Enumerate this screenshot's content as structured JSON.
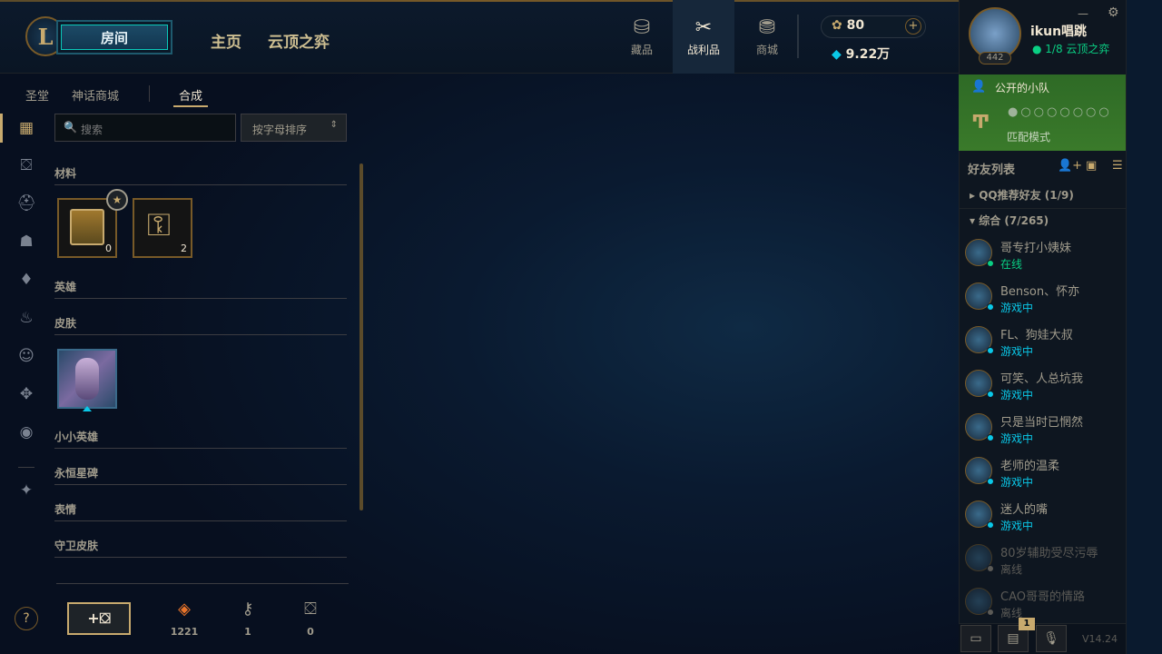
{
  "topbar": {
    "play_label": "房间",
    "nav": [
      "主页",
      "云顶之弈"
    ],
    "icons": [
      {
        "label": "藏品",
        "icon": "collection-icon"
      },
      {
        "label": "战利品",
        "icon": "loot-icon"
      },
      {
        "label": "商城",
        "icon": "store-icon"
      }
    ],
    "rp": "80",
    "be": "9.22万"
  },
  "profile": {
    "name": "ikun唱跳",
    "level": "442",
    "status": "1/8 云顶之弈"
  },
  "party": {
    "title": "公开的小队",
    "mode": "匹配模式"
  },
  "friends": {
    "header": "好友列表",
    "groups": [
      "QQ推荐好友 (1/9)",
      "综合 (7/265)"
    ],
    "list": [
      {
        "name": "哥专打小姨妹",
        "status": "在线",
        "color": "#0acf83"
      },
      {
        "name": "Benson、怀亦",
        "status": "游戏中",
        "color": "#0ac8e8"
      },
      {
        "name": "FL、狗娃大叔",
        "status": "游戏中",
        "color": "#0ac8e8"
      },
      {
        "name": "可笑、人总坑我",
        "status": "游戏中",
        "color": "#0ac8e8"
      },
      {
        "name": "只是当时已惘然",
        "status": "游戏中",
        "color": "#0ac8e8"
      },
      {
        "name": "老师的温柔",
        "status": "游戏中",
        "color": "#0ac8e8"
      },
      {
        "name": "迷人的嘴",
        "status": "游戏中",
        "color": "#0ac8e8"
      },
      {
        "name": "80岁辅助受尽污辱",
        "status": "离线",
        "color": "#5b5a56"
      },
      {
        "name": "CAO哥哥的情路",
        "status": "离线",
        "color": "#5b5a56"
      }
    ],
    "notif_count": "1",
    "version": "V14.24"
  },
  "loot": {
    "subtabs": [
      "圣堂",
      "神话商城",
      "合成"
    ],
    "search_placeholder": "搜索",
    "sort_label": "按字母排序",
    "categories": [
      "材料",
      "英雄",
      "皮肤",
      "小小英雄",
      "永恒星碑",
      "表情",
      "守卫皮肤"
    ],
    "materials": [
      {
        "name": "chest",
        "count": "0"
      },
      {
        "name": "key",
        "count": "2"
      }
    ],
    "bottom": [
      {
        "icon": "orange-essence-icon",
        "value": "1221"
      },
      {
        "icon": "key-fragment-icon",
        "value": "1"
      },
      {
        "icon": "chest-icon",
        "value": "0"
      }
    ]
  }
}
